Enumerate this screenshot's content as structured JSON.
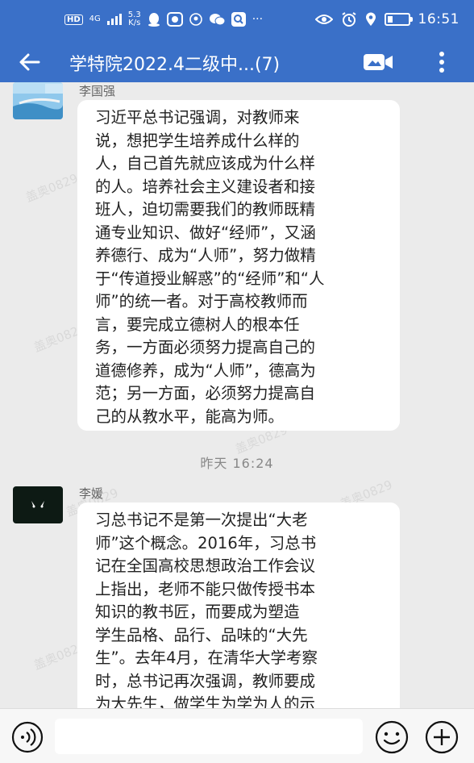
{
  "status": {
    "hd": "HD",
    "net_type": "4G",
    "speed_value": "5.3",
    "speed_unit": "K/s",
    "more": "···",
    "time": "16:51"
  },
  "header": {
    "title": "学特院2022.4二级中...(7)"
  },
  "messages": [
    {
      "sender": "李国强",
      "lines": [
        "习近平总书记强调，对教师来",
        "说，想把学生培养成什么样的",
        "人，自己首先就应该成为什么样",
        "的人。培养社会主义建设者和接",
        "班人，迫切需要我们的教师既精",
        "通专业知识、做好“经师”，又涵",
        "养德行、成为“人师”，努力做精",
        "于“传道授业解惑”的“经师”和“人",
        "师”的统一者。对于高校教师而",
        "言，要完成立德树人的根本任",
        "务，一方面必须努力提高自己的",
        "道德修养，成为“人师”，德高为",
        "范；另一方面，必须努力提高自",
        "己的从教水平，能高为师。"
      ]
    },
    {
      "sender": "李媛",
      "lines": [
        "习总书记不是第一次提出“大老",
        "师”这个概念。2016年，习总书",
        "记在全国高校思想政治工作会议",
        "上指出，老师不能只做传授书本",
        "知识的教书匠，而要成为塑造",
        "学生品格、品行、品味的“大先",
        "生”。去年4月，在清华大学考察",
        "时，总书记再次强调，教师要成",
        "为大先生，做学生为学为人的示"
      ]
    }
  ],
  "time_separator": "昨天  16:24",
  "watermark": "盖奥0829",
  "input": {
    "placeholder": ""
  }
}
